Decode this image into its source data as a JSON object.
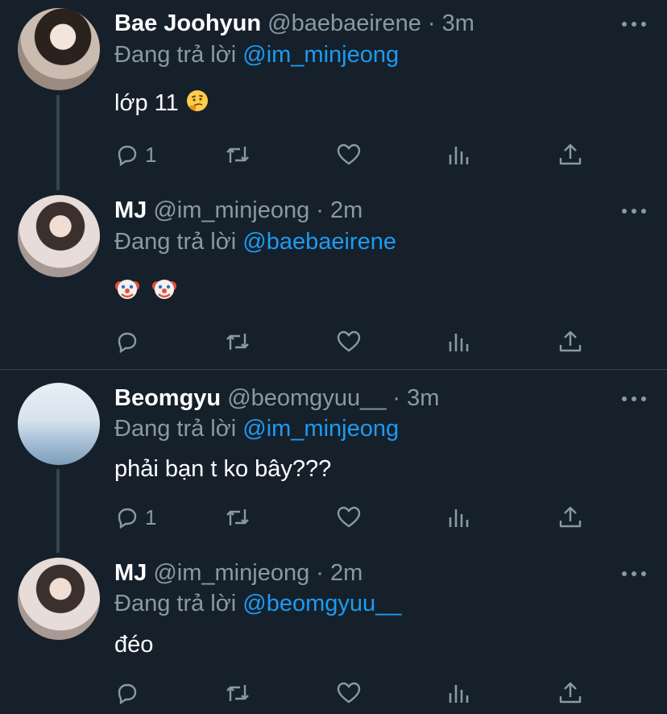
{
  "tweets": [
    {
      "name": "Bae Joohyun",
      "handle": "@baebaeirene",
      "time": "3m",
      "reply_prefix": "Đang trả lời",
      "reply_to": "@im_minjeong",
      "text": "lớp 11",
      "emoji": "thinking-face",
      "reply_count": "1"
    },
    {
      "name": "MJ",
      "handle": "@im_minjeong",
      "time": "2m",
      "reply_prefix": "Đang trả lời",
      "reply_to": "@baebaeirene",
      "text": "",
      "emoji": "clown-face x2",
      "reply_count": ""
    },
    {
      "name": "Beomgyu",
      "handle": "@beomgyuu__",
      "time": "3m",
      "reply_prefix": "Đang trả lời",
      "reply_to": "@im_minjeong",
      "text": "phải bạn t ko bây???",
      "reply_count": "1"
    },
    {
      "name": "MJ",
      "handle": "@im_minjeong",
      "time": "2m",
      "reply_prefix": "Đang trả lời",
      "reply_to": "@beomgyuu__",
      "text": "đéo",
      "reply_count": ""
    }
  ],
  "separator": "·",
  "colors": {
    "background": "#15202b",
    "secondary_text": "#8b98a5",
    "mention": "#1d9bf0",
    "divider": "#38444d"
  }
}
